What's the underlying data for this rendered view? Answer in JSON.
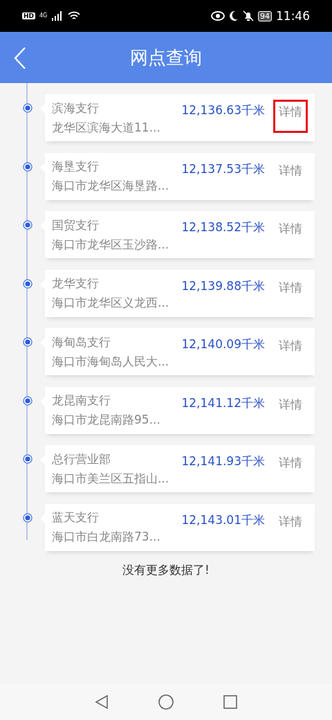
{
  "status_bar": {
    "hd": "HD",
    "network": "4G",
    "battery": "94",
    "time": "11:46"
  },
  "header": {
    "title": "网点查询"
  },
  "branches": [
    {
      "name": "滨海支行",
      "address": "龙华区滨海大道11...",
      "distance": "12,136.63千米",
      "action": "详情",
      "highlighted": true
    },
    {
      "name": "海垦支行",
      "address": "海口市龙华区海垦路...",
      "distance": "12,137.53千米",
      "action": "详情",
      "highlighted": false
    },
    {
      "name": "国贸支行",
      "address": "海口市龙华区玉沙路...",
      "distance": "12,138.52千米",
      "action": "详情",
      "highlighted": false
    },
    {
      "name": "龙华支行",
      "address": "海口市龙华区义龙西...",
      "distance": "12,139.88千米",
      "action": "详情",
      "highlighted": false
    },
    {
      "name": "海甸岛支行",
      "address": "海口市海甸岛人民大...",
      "distance": "12,140.09千米",
      "action": "详情",
      "highlighted": false
    },
    {
      "name": "龙昆南支行",
      "address": "海口市龙昆南路95...",
      "distance": "12,141.12千米",
      "action": "详情",
      "highlighted": false
    },
    {
      "name": "总行营业部",
      "address": "海口市美兰区五指山...",
      "distance": "12,141.93千米",
      "action": "详情",
      "highlighted": false
    },
    {
      "name": "蓝天支行",
      "address": "海口市白龙南路73...",
      "distance": "12,143.01千米",
      "action": "详情",
      "highlighted": false
    }
  ],
  "footer_note": "没有更多数据了!"
}
